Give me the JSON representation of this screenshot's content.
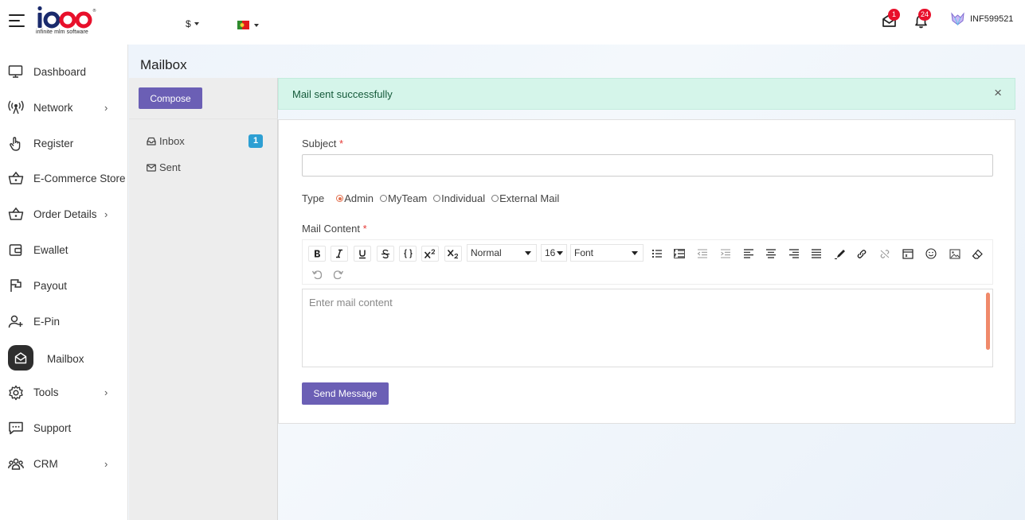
{
  "header": {
    "logo_text": "infinite mlm software",
    "currency": "$",
    "mail_badge": "1",
    "notification_badge": "24",
    "username": "INF599521"
  },
  "sidebar": {
    "items": [
      {
        "label": "Dashboard",
        "icon": "monitor-icon"
      },
      {
        "label": "Network",
        "icon": "antenna-icon",
        "chevron": "›"
      },
      {
        "label": "Register",
        "icon": "hand-pointer-icon"
      },
      {
        "label": "E-Commerce Store",
        "icon": "basket-icon"
      },
      {
        "label": "Order Details",
        "icon": "basket-icon",
        "chevron": "›"
      },
      {
        "label": "Ewallet",
        "icon": "wallet-icon"
      },
      {
        "label": "Payout",
        "icon": "flag-icon"
      },
      {
        "label": "E-Pin",
        "icon": "user-plus-icon"
      },
      {
        "label": "Mailbox",
        "icon": "envelope-open-icon",
        "active": true
      },
      {
        "label": "Tools",
        "icon": "gear-icon",
        "chevron": "›"
      },
      {
        "label": "Support",
        "icon": "chat-icon"
      },
      {
        "label": "CRM",
        "icon": "users-icon",
        "chevron": "›"
      }
    ]
  },
  "mailbox": {
    "title": "Mailbox",
    "compose_label": "Compose",
    "folders": [
      {
        "label": "Inbox",
        "icon": "inbox-icon",
        "count": "1"
      },
      {
        "label": "Sent",
        "icon": "envelope-icon"
      }
    ]
  },
  "alert": {
    "message": "Mail sent successfully",
    "close": "×"
  },
  "form": {
    "subject_label": "Subject",
    "required_mark": "*",
    "type_label": "Type",
    "type_options": [
      "Admin",
      "MyTeam",
      "Individual",
      "External Mail"
    ],
    "type_selected": "Admin",
    "content_label": "Mail Content",
    "content_placeholder": "Enter mail content",
    "send_label": "Send Message"
  },
  "toolbar": {
    "paragraph": "Normal",
    "size": "16",
    "font": "Font"
  },
  "colors": {
    "accent": "#6b5fb5",
    "success_bg": "#d5f5ea",
    "badge_red": "#e8102b",
    "badge_blue": "#2d9fd3",
    "radio_active": "#e2704e"
  }
}
